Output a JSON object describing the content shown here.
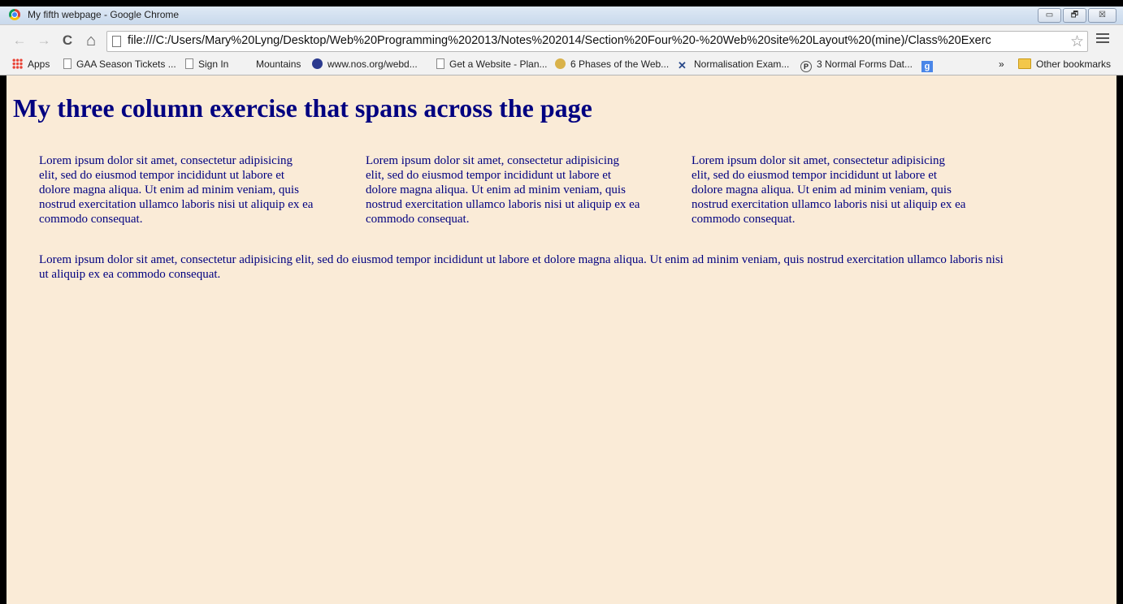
{
  "window": {
    "title": "My fifth webpage - Google Chrome",
    "controls": {
      "minimize": "▭",
      "restore": "🗗",
      "close": "☒"
    }
  },
  "toolbar": {
    "back_icon": "←",
    "forward_icon": "→",
    "reload_icon": "C",
    "home_icon": "⌂",
    "url": "file:///C:/Users/Mary%20Lyng/Desktop/Web%20Programming%202013/Notes%202014/Section%20Four%20-%20Web%20site%20Layout%20(mine)/Class%20Exerc",
    "star_icon": "☆"
  },
  "bookmarks": {
    "items": [
      {
        "label": "Apps",
        "icon": "apps-grid-icon"
      },
      {
        "label": "GAA Season Tickets ...",
        "icon": "page-icon"
      },
      {
        "label": "Sign In",
        "icon": "page-icon"
      },
      {
        "label": "Mountains",
        "icon": "none"
      },
      {
        "label": "www.nos.org/webd...",
        "icon": "nos-icon"
      },
      {
        "label": "Get a Website - Plan...",
        "icon": "page-icon"
      },
      {
        "label": "6 Phases of the Web...",
        "icon": "phases-icon"
      },
      {
        "label": "Normalisation Exam...",
        "icon": "normalisation-icon"
      },
      {
        "label": "3 Normal Forms Dat...",
        "icon": "p-icon"
      },
      {
        "label": "",
        "icon": "google-g-icon"
      }
    ],
    "overflow": "»",
    "other": "Other bookmarks"
  },
  "page": {
    "background": "#faebd7",
    "text_color": "#000080",
    "heading": "My three column exercise that spans across the page",
    "columns": [
      "Lorem ipsum dolor sit amet, consectetur adipisicing elit, sed do eiusmod tempor incididunt ut labore et dolore magna aliqua. Ut enim ad minim veniam, quis nostrud exercitation ullamco laboris nisi ut aliquip ex ea commodo consequat.",
      "Lorem ipsum dolor sit amet, consectetur adipisicing elit, sed do eiusmod tempor incididunt ut labore et dolore magna aliqua. Ut enim ad minim veniam, quis nostrud exercitation ullamco laboris nisi ut aliquip ex ea commodo consequat.",
      "Lorem ipsum dolor sit amet, consectetur adipisicing elit, sed do eiusmod tempor incididunt ut labore et dolore magna aliqua. Ut enim ad minim veniam, quis nostrud exercitation ullamco laboris nisi ut aliquip ex ea commodo consequat."
    ],
    "footer_paragraph": "Lorem ipsum dolor sit amet, consectetur adipisicing elit, sed do eiusmod tempor incididunt ut labore et dolore magna aliqua. Ut enim ad minim veniam, quis nostrud exercitation ullamco laboris nisi ut aliquip ex ea commodo consequat."
  }
}
